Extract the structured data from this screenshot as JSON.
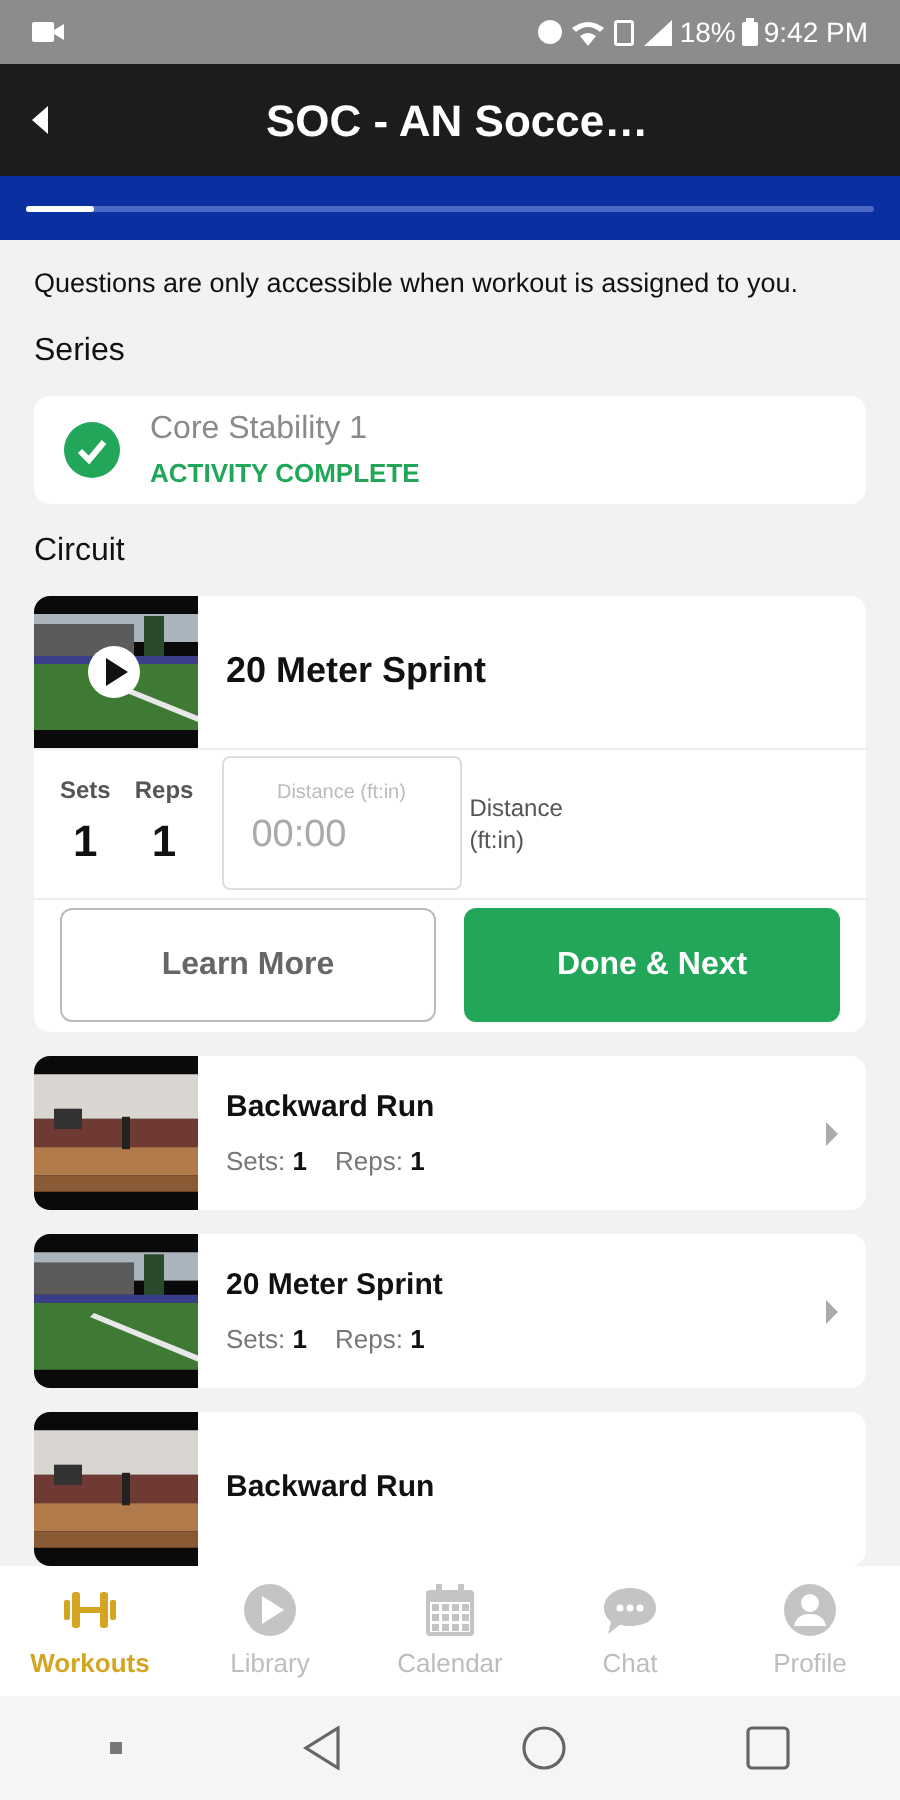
{
  "status_bar": {
    "battery": "18%",
    "time": "9:42 PM"
  },
  "header": {
    "title": "SOC - AN Socce…"
  },
  "progress": {
    "level": 0.08
  },
  "notice": "Questions are only accessible when workout is assigned to you.",
  "series": {
    "heading": "Series",
    "item": {
      "name": "Core Stability 1",
      "status": "ACTIVITY COMPLETE",
      "completed": true
    }
  },
  "circuit": {
    "heading": "Circuit",
    "current": {
      "title": "20 Meter Sprint",
      "sets_label": "Sets",
      "sets": "1",
      "reps_label": "Reps",
      "reps": "1",
      "field_label": "Distance (ft:in)",
      "field_placeholder": "00:00",
      "unit_label": "Distance (ft:in)",
      "buttons": [
        {
          "label": "Learn More",
          "kind": "outline"
        },
        {
          "label": "Done & Next",
          "kind": "primary"
        }
      ]
    },
    "items": [
      {
        "title": "Backward Run",
        "sets_label": "Sets:",
        "sets": "1",
        "reps_label": "Reps:",
        "reps": "1"
      },
      {
        "title": "20 Meter Sprint",
        "sets_label": "Sets:",
        "sets": "1",
        "reps_label": "Reps:",
        "reps": "1"
      },
      {
        "title": "Backward Run"
      }
    ]
  },
  "tabs": [
    {
      "label": "Workouts",
      "selected": true
    },
    {
      "label": "Library",
      "selected": false
    },
    {
      "label": "Calendar",
      "selected": false
    },
    {
      "label": "Chat",
      "selected": false
    },
    {
      "label": "Profile",
      "selected": false
    }
  ]
}
